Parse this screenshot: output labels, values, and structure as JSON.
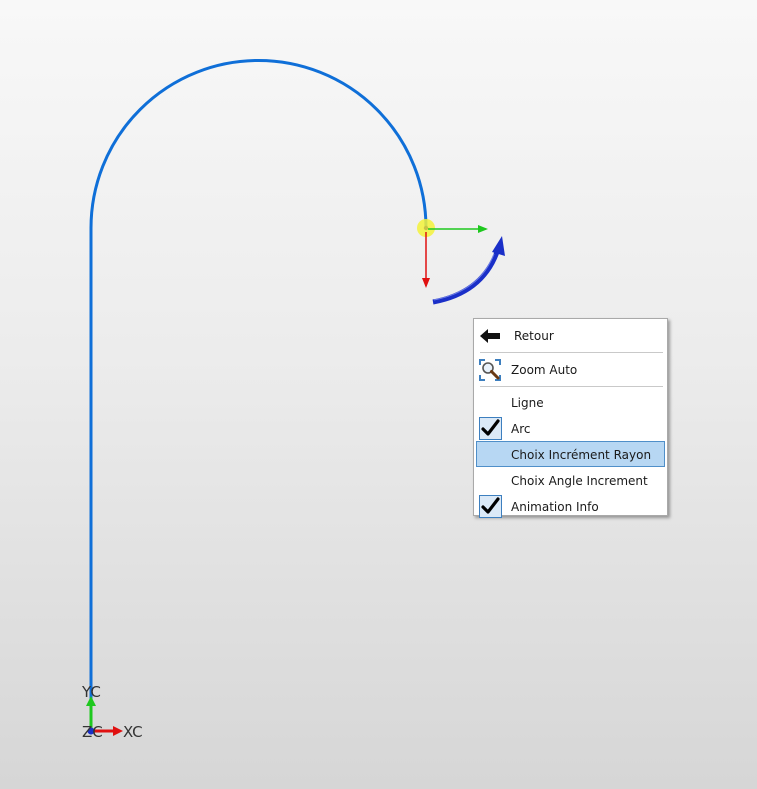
{
  "viewport": {
    "background_top": "#f8f8f8",
    "background_bottom": "#d6d6d6"
  },
  "sketch": {
    "curve_color": "#0f6fd8",
    "vector_green": "#1ec81e",
    "vector_red": "#e01010",
    "arc_handle_blue": "#1a2fc8",
    "point_marker": "#f3f23a"
  },
  "axes": {
    "y_label": "YC",
    "x_label": "XC",
    "z_label": "ZC"
  },
  "context_menu": {
    "items": [
      {
        "id": "retour",
        "label": "Retour",
        "icon": "back-arrow-icon",
        "checked": false
      },
      {
        "id": "zoom-auto",
        "label": "Zoom Auto",
        "icon": "zoom-auto-icon",
        "checked": false
      },
      {
        "id": "ligne",
        "label": "Ligne",
        "icon": "",
        "checked": false
      },
      {
        "id": "arc",
        "label": "Arc",
        "icon": "checkmark-icon",
        "checked": true
      },
      {
        "id": "choix-increment-rayon",
        "label": "Choix Incrément Rayon",
        "icon": "",
        "checked": false,
        "highlighted": true
      },
      {
        "id": "choix-angle-increment",
        "label": "Choix Angle Increment",
        "icon": "",
        "checked": false
      },
      {
        "id": "animation-info",
        "label": "Animation Info",
        "icon": "checkmark-icon",
        "checked": true
      }
    ]
  }
}
